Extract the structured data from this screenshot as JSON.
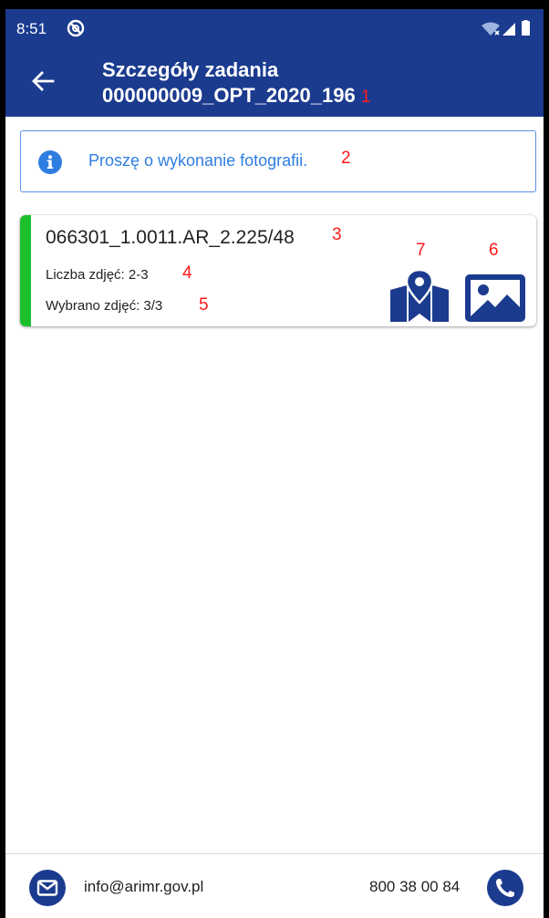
{
  "status_bar": {
    "time": "8:51"
  },
  "app_bar": {
    "title": "Szczegóły zadania",
    "subtitle": "000000009_OPT_2020_196",
    "subtitle_annotation": "1"
  },
  "info": {
    "text": "Proszę o wykonanie fotografii.",
    "annotation": "2",
    "icon": "info-icon"
  },
  "card": {
    "title": "066301_1.0011.AR_2.225/48",
    "title_annotation": "3",
    "photo_count_label": "Liczba zdjęć: 2-3",
    "photo_count_annotation": "4",
    "selected_label": "Wybrano zdjęć: 3/3",
    "selected_annotation": "5",
    "map_annotation": "7",
    "image_annotation": "6",
    "accent_color": "#1bbf2c"
  },
  "footer": {
    "email": "info@arimr.gov.pl",
    "phone": "800 38 00 84"
  },
  "colors": {
    "primary": "#1b3b8f",
    "annotation": "#ff1a1a",
    "info_text": "#2f7de1"
  }
}
